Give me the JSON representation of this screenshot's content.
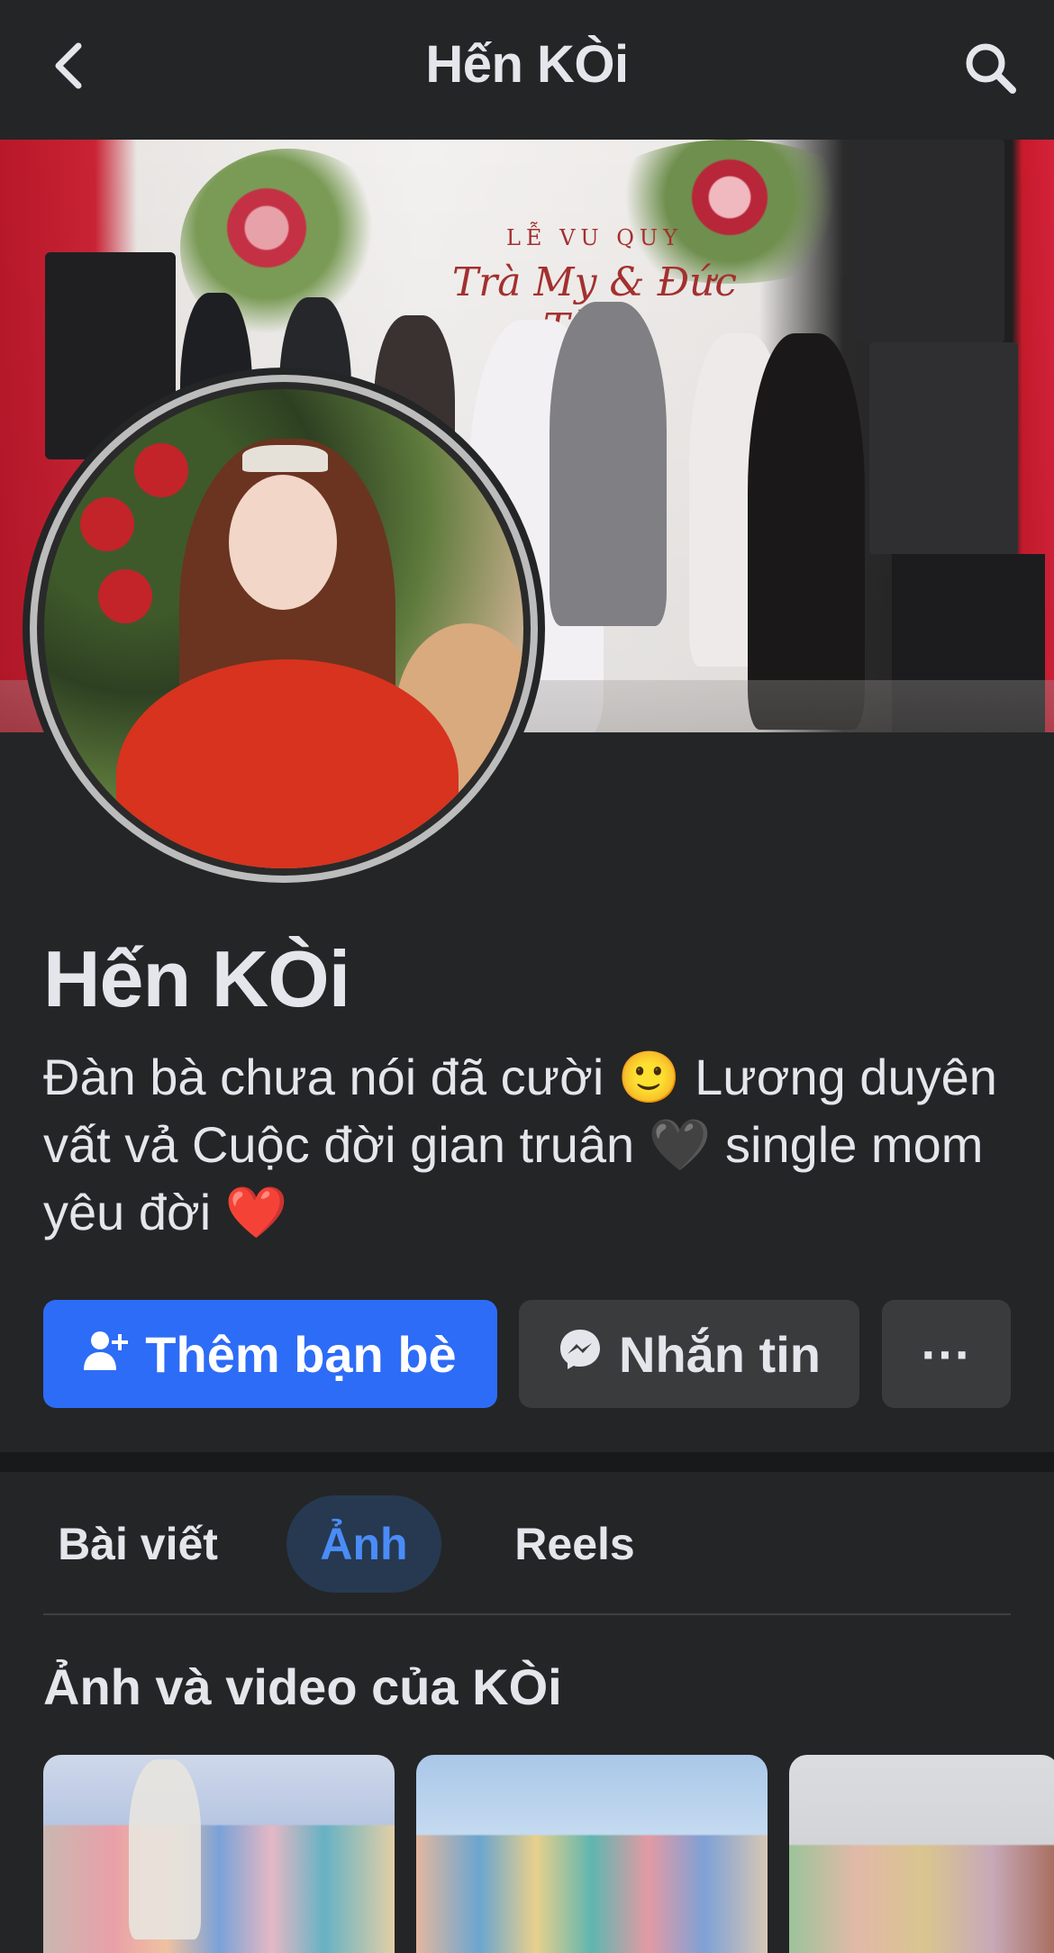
{
  "header": {
    "title": "Hến KÒi",
    "back_icon": "chevron-left-icon",
    "search_icon": "search-icon"
  },
  "cover": {
    "banner_line1": "LỄ VU QUY",
    "banner_line2": "Trà My & Đức Tùng"
  },
  "profile": {
    "name": "Hến KÒi",
    "bio": "Đàn bà chưa nói đã cười 🙂 Lương duyên vất vả Cuộc đời gian truân 🖤 single mom yêu đời ❤️"
  },
  "actions": {
    "add_friend_label": "Thêm bạn bè",
    "message_label": "Nhắn tin",
    "more_label": "···"
  },
  "tabs": [
    {
      "label": "Bài viết",
      "active": false
    },
    {
      "label": "Ảnh",
      "active": true
    },
    {
      "label": "Reels",
      "active": false
    }
  ],
  "photos_section": {
    "title": "Ảnh và video của KÒi"
  },
  "colors": {
    "background": "#242526",
    "primary_button": "#2d6cf6",
    "secondary_button": "#3a3b3c",
    "active_tab_bg": "#263951",
    "active_tab_text": "#4a8cf7",
    "text": "#e4e6eb"
  }
}
